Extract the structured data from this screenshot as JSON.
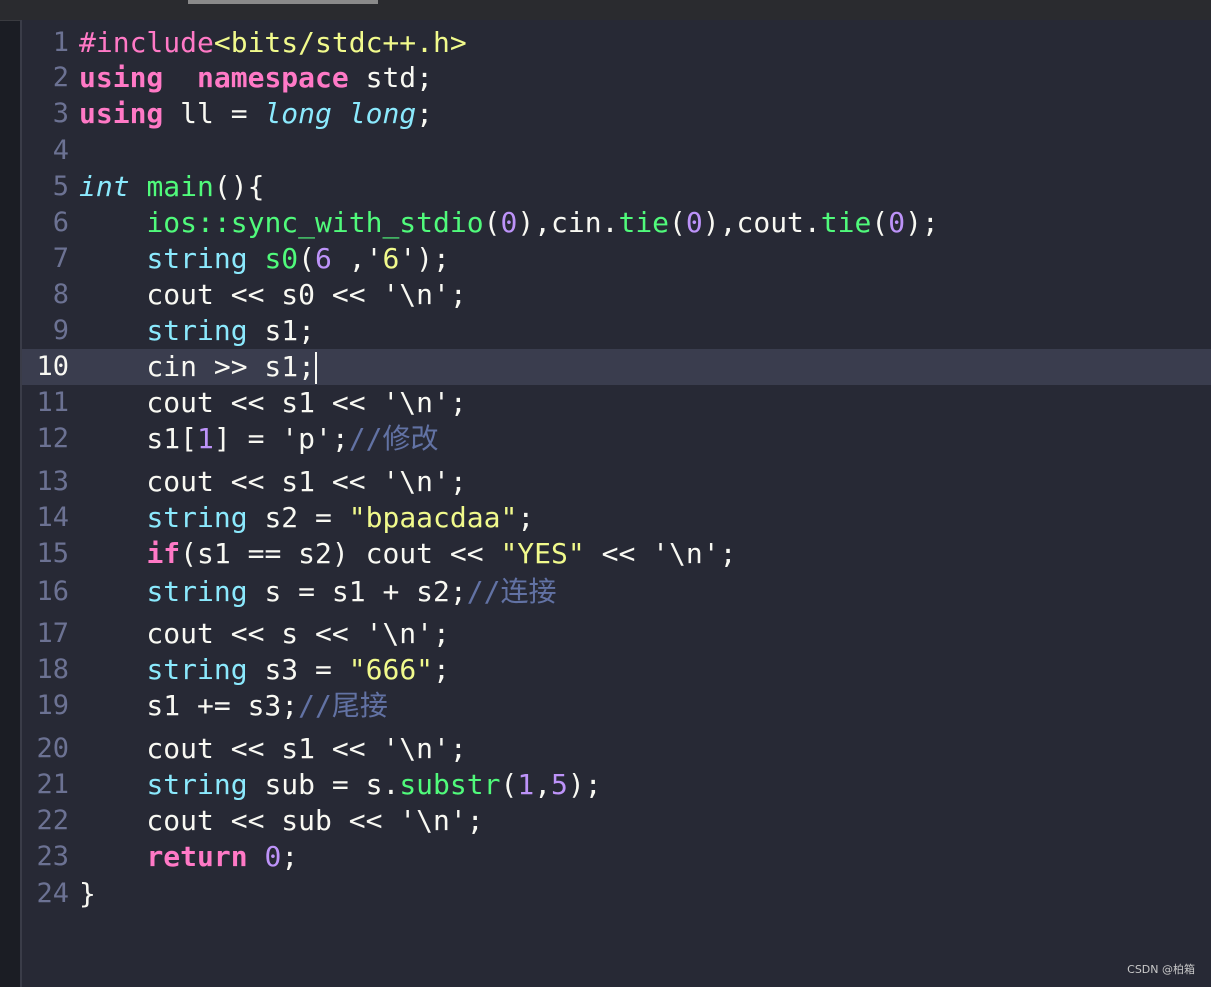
{
  "editor": {
    "current_line": 10,
    "lines": [
      {
        "n": "1",
        "t": [
          [
            "pre",
            "#include"
          ],
          [
            "inc",
            "<bits/stdc++.h>"
          ]
        ]
      },
      {
        "n": "2",
        "t": [
          [
            "kw",
            "using"
          ],
          [
            "",
            "  "
          ],
          [
            "kw",
            "namespace"
          ],
          [
            "",
            " std;"
          ]
        ]
      },
      {
        "n": "3",
        "t": [
          [
            "kw",
            "using"
          ],
          [
            "",
            " ll = "
          ],
          [
            "ty",
            "long long"
          ],
          [
            "",
            ";"
          ]
        ]
      },
      {
        "n": "4",
        "t": []
      },
      {
        "n": "5",
        "t": [
          [
            "ty",
            "int"
          ],
          [
            "",
            " "
          ],
          [
            "fn",
            "main"
          ],
          [
            "",
            "(){"
          ]
        ]
      },
      {
        "n": "6",
        "t": [
          [
            "",
            "    "
          ],
          [
            "fn",
            "ios::sync_with_stdio"
          ],
          [
            "",
            "("
          ],
          [
            "num",
            "0"
          ],
          [
            "",
            "),cin."
          ],
          [
            "fn",
            "tie"
          ],
          [
            "",
            "("
          ],
          [
            "num",
            "0"
          ],
          [
            "",
            "),cout."
          ],
          [
            "fn",
            "tie"
          ],
          [
            "",
            "("
          ],
          [
            "num",
            "0"
          ],
          [
            "",
            ");"
          ]
        ]
      },
      {
        "n": "7",
        "t": [
          [
            "",
            "    "
          ],
          [
            "ty2",
            "string"
          ],
          [
            "",
            " "
          ],
          [
            "fn",
            "s0"
          ],
          [
            "",
            "("
          ],
          [
            "num",
            "6"
          ],
          [
            "",
            " ,'"
          ],
          [
            "str",
            "6"
          ],
          [
            "",
            "');"
          ]
        ]
      },
      {
        "n": "8",
        "t": [
          [
            "",
            "    cout << s0 << '\\n';"
          ]
        ]
      },
      {
        "n": "9",
        "t": [
          [
            "",
            "    "
          ],
          [
            "ty2",
            "string"
          ],
          [
            "",
            " s1;"
          ]
        ]
      },
      {
        "n": "10",
        "t": [
          [
            "",
            "    cin >> s1;"
          ]
        ]
      },
      {
        "n": "11",
        "t": [
          [
            "",
            "    cout << s1 << '\\n';"
          ]
        ]
      },
      {
        "n": "12",
        "t": [
          [
            "",
            "    s1["
          ],
          [
            "num",
            "1"
          ],
          [
            "",
            "] = 'p';"
          ],
          [
            "cm",
            "//修改"
          ]
        ]
      },
      {
        "n": "13",
        "t": [
          [
            "",
            "    cout << s1 << '\\n';"
          ]
        ]
      },
      {
        "n": "14",
        "t": [
          [
            "",
            "    "
          ],
          [
            "ty2",
            "string"
          ],
          [
            "",
            " s2 = "
          ],
          [
            "str",
            "\"bpaacdaa\""
          ],
          [
            "",
            ";"
          ]
        ]
      },
      {
        "n": "15",
        "t": [
          [
            "",
            "    "
          ],
          [
            "kw",
            "if"
          ],
          [
            "",
            "(s1 == s2) cout << "
          ],
          [
            "str",
            "\"YES\""
          ],
          [
            "",
            " << '\\n';"
          ]
        ]
      },
      {
        "n": "16",
        "t": [
          [
            "",
            "    "
          ],
          [
            "ty2",
            "string"
          ],
          [
            "",
            " s = s1 + s2;"
          ],
          [
            "cm",
            "//连接"
          ]
        ]
      },
      {
        "n": "17",
        "t": [
          [
            "",
            "    cout << s << '\\n';"
          ]
        ]
      },
      {
        "n": "18",
        "t": [
          [
            "",
            "    "
          ],
          [
            "ty2",
            "string"
          ],
          [
            "",
            " s3 = "
          ],
          [
            "str",
            "\"666\""
          ],
          [
            "",
            ";"
          ]
        ]
      },
      {
        "n": "19",
        "t": [
          [
            "",
            "    s1 += s3;"
          ],
          [
            "cm",
            "//尾接"
          ]
        ]
      },
      {
        "n": "20",
        "t": [
          [
            "",
            "    cout << s1 << '\\n';"
          ]
        ]
      },
      {
        "n": "21",
        "t": [
          [
            "",
            "    "
          ],
          [
            "ty2",
            "string"
          ],
          [
            "",
            " sub = s."
          ],
          [
            "fn",
            "substr"
          ],
          [
            "",
            "("
          ],
          [
            "num",
            "1"
          ],
          [
            "",
            ","
          ],
          [
            "num",
            "5"
          ],
          [
            "",
            ");"
          ]
        ]
      },
      {
        "n": "22",
        "t": [
          [
            "",
            "    cout << sub << '\\n';"
          ]
        ]
      },
      {
        "n": "23",
        "t": [
          [
            "",
            "    "
          ],
          [
            "kw",
            "return"
          ],
          [
            "",
            " "
          ],
          [
            "num",
            "0"
          ],
          [
            "",
            ";"
          ]
        ]
      },
      {
        "n": "24",
        "t": [
          [
            "",
            "}"
          ]
        ]
      }
    ]
  },
  "watermark": "CSDN @柏箱",
  "colors": {
    "background": "#272935",
    "keyword": "#ff79c6",
    "type": "#8be9fd",
    "function": "#50fa7b",
    "number": "#bd93f9",
    "string": "#f1fa8c",
    "comment": "#6272a4"
  }
}
